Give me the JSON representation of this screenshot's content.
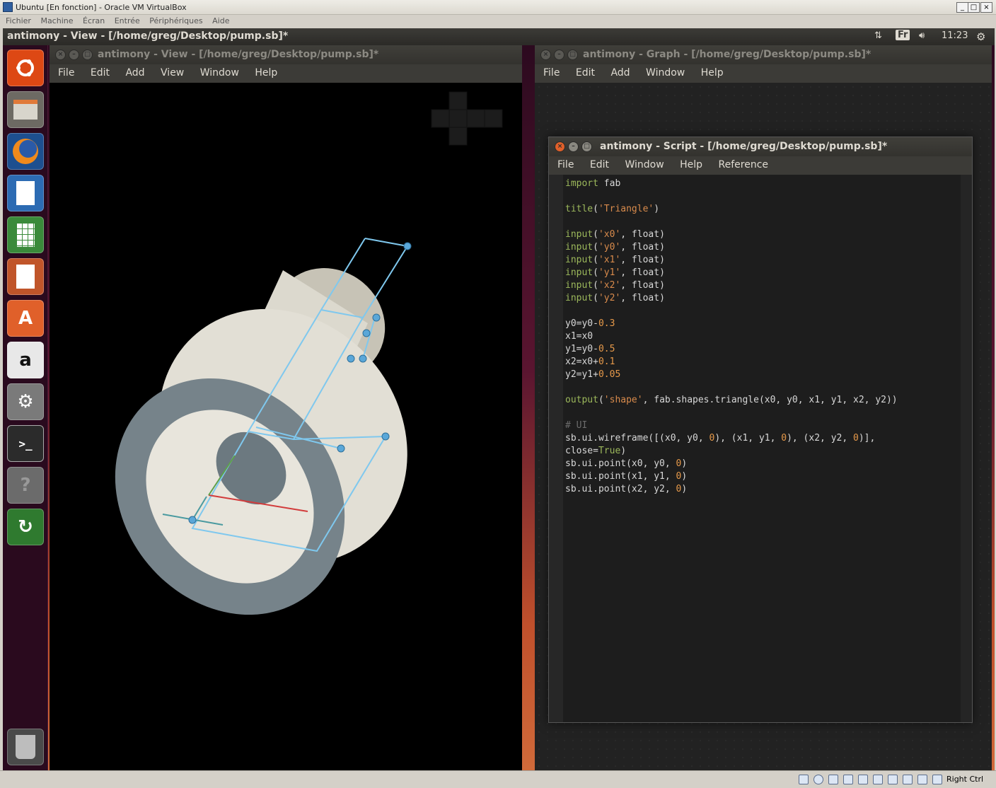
{
  "vbox": {
    "title": "Ubuntu [En fonction] - Oracle VM VirtualBox",
    "menu": [
      "Fichier",
      "Machine",
      "Écran",
      "Entrée",
      "Périphériques",
      "Aide"
    ],
    "host_key": "Right Ctrl"
  },
  "panel": {
    "title": "antimony - View - [/home/greg/Desktop/pump.sb]*",
    "keyboard": "Fr",
    "time": "11:23"
  },
  "launcher": [
    "ubuntu-dash",
    "files",
    "firefox",
    "writer",
    "calc",
    "impress",
    "software-center",
    "amazon",
    "system-settings",
    "terminal",
    "help",
    "software-updater",
    "trash"
  ],
  "view_window": {
    "title": "antimony - View - [/home/greg/Desktop/pump.sb]*",
    "menu": [
      "File",
      "Edit",
      "Add",
      "View",
      "Window",
      "Help"
    ]
  },
  "graph_window": {
    "title": "antimony - Graph - [/home/greg/Desktop/pump.sb]*",
    "menu": [
      "File",
      "Edit",
      "Add",
      "Window",
      "Help"
    ]
  },
  "script_window": {
    "title": "antimony - Script - [/home/greg/Desktop/pump.sb]*",
    "menu": [
      "File",
      "Edit",
      "Window",
      "Help",
      "Reference"
    ],
    "code": [
      "import fab",
      "",
      "title('Triangle')",
      "",
      "input('x0', float)",
      "input('y0', float)",
      "input('x1', float)",
      "input('y1', float)",
      "input('x2', float)",
      "input('y2', float)",
      "",
      "y0=y0-0.3",
      "x1=x0",
      "y1=y0-0.5",
      "x2=x0+0.1",
      "y2=y1+0.05",
      "",
      "output('shape', fab.shapes.triangle(x0, y0, x1, y1, x2, y2))",
      "",
      "# UI",
      "sb.ui.wireframe([(x0, y0, 0), (x1, y1, 0), (x2, y2, 0)],",
      "close=True)",
      "sb.ui.point(x0, y0, 0)",
      "sb.ui.point(x1, y1, 0)",
      "sb.ui.point(x2, y2, 0)"
    ]
  },
  "colors": {
    "accent_wireframe": "#7fc8ee",
    "model": "#d9d6cc",
    "panel_bg": "#3c3b37"
  }
}
